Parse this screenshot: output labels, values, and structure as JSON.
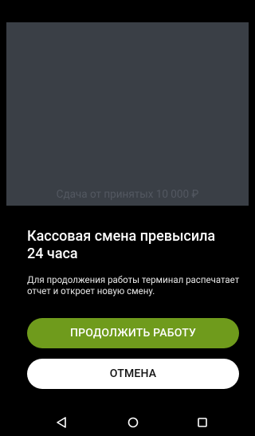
{
  "background": {
    "hint_text": "Сдача от принятых 10 000 ₽"
  },
  "dialog": {
    "title": "Кассовая смена превысила 24 часа",
    "message": "Для продолжения работы терминал распечатает отчет и откроет новую смену.",
    "continue_label": "ПРОДОЛЖИТЬ РАБОТУ",
    "cancel_label": "ОТМЕНА"
  },
  "colors": {
    "primary_button": "#6f9b1c",
    "secondary_button": "#ffffff",
    "dim_overlay": "#3a3f46"
  },
  "nav_bar": {
    "icons": [
      "back-icon",
      "home-icon",
      "recents-icon"
    ]
  }
}
